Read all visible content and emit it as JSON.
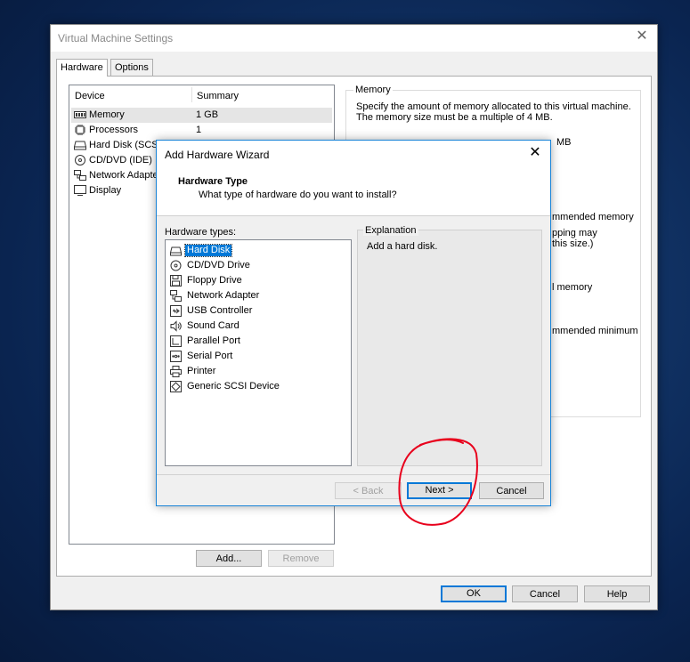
{
  "settings": {
    "title": "Virtual Machine Settings",
    "tabs": [
      "Hardware",
      "Options"
    ],
    "device_header": "Device",
    "summary_header": "Summary",
    "devices": [
      {
        "name": "Memory",
        "summary": "1 GB",
        "icon": "memory-icon"
      },
      {
        "name": "Processors",
        "summary": "1",
        "icon": "processor-icon"
      },
      {
        "name": "Hard Disk (SCSI)",
        "summary": "",
        "icon": "hard-disk-icon"
      },
      {
        "name": "CD/DVD (IDE)",
        "summary": "",
        "icon": "cd-dvd-icon"
      },
      {
        "name": "Network Adapter",
        "summary": "",
        "icon": "network-adapter-icon"
      },
      {
        "name": "Display",
        "summary": "",
        "icon": "display-icon"
      }
    ],
    "add_button": "Add...",
    "remove_button": "Remove",
    "memory_group": "Memory",
    "memory_desc": "Specify the amount of memory allocated to this virtual machine. The memory size must be a multiple of 4 MB.",
    "memory_unit": "MB",
    "fragments": [
      "mmended memory",
      "pping may",
      "this size.)",
      "l memory",
      "mmended minimum"
    ],
    "ok": "OK",
    "cancel": "Cancel",
    "help": "Help"
  },
  "wizard": {
    "title": "Add Hardware Wizard",
    "header_title": "Hardware Type",
    "header_subtitle": "What type of hardware do you want to install?",
    "types_label": "Hardware types:",
    "types": [
      {
        "name": "Hard Disk",
        "icon": "hard-disk-icon",
        "selected": true
      },
      {
        "name": "CD/DVD Drive",
        "icon": "cd-dvd-icon"
      },
      {
        "name": "Floppy Drive",
        "icon": "floppy-icon"
      },
      {
        "name": "Network Adapter",
        "icon": "network-adapter-icon"
      },
      {
        "name": "USB Controller",
        "icon": "usb-icon"
      },
      {
        "name": "Sound Card",
        "icon": "sound-icon"
      },
      {
        "name": "Parallel Port",
        "icon": "parallel-port-icon"
      },
      {
        "name": "Serial Port",
        "icon": "serial-port-icon"
      },
      {
        "name": "Printer",
        "icon": "printer-icon"
      },
      {
        "name": "Generic SCSI Device",
        "icon": "scsi-icon"
      }
    ],
    "explanation_label": "Explanation",
    "explanation_text": "Add a hard disk.",
    "back": "< Back",
    "next": "Next >",
    "cancel": "Cancel"
  },
  "colors": {
    "accent": "#0078d7",
    "annotation": "#e8001c"
  }
}
